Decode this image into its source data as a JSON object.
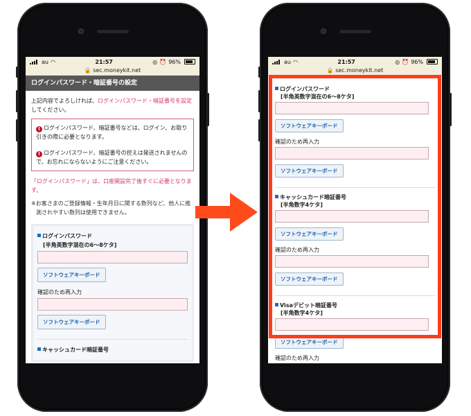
{
  "status": {
    "carrier": "au",
    "time": "21:57",
    "battery": "96%"
  },
  "url": "sec.moneykit.net",
  "left_screen": {
    "header": "ログインパスワード・暗証番号の設定",
    "intro_before": "上記内容でよろしければ、",
    "intro_link": "ログインパスワード・暗証番号を設定",
    "intro_after": "してください。",
    "notices": [
      "ログインパスワード、暗証番号などは、ログイン、お取り引きの際に必要となります。",
      "ログインパスワード、暗証番号の控えは発送されませんので、お忘れにならないようにご注意ください。"
    ],
    "pink_note": "「ログインパスワード」は、口座開設完了後すぐに必要となります。",
    "gray_note": "※お客さまのご登録情報・生年月日に関する数列など、他人に推測されやすい数列は使用できません。",
    "section1_title": "ログインパスワード",
    "section1_sub": "[半角英数字混在の6～8ケタ]",
    "keyboard_button": "ソフトウェアキーボード",
    "confirm_label": "確認のため再入力",
    "section2_title": "キャッシュカード暗証番号"
  },
  "right_screen": {
    "section1_title": "ログインパスワード",
    "section1_sub": "[半角英数字混在の6～8ケタ]",
    "section2_title": "キャッシュカード暗証番号",
    "section2_sub": "[半角数字4ケタ]",
    "section3_title": "Visaデビット暗証番号",
    "section3_sub": "[半角数字4ケタ]",
    "keyboard_button": "ソフトウェアキーボード",
    "confirm_label": "確認のため再入力"
  },
  "colors": {
    "highlight": "#ff3d1a",
    "arrow": "#ff4a1c",
    "link_pink": "#d6336c"
  },
  "icons": [
    "signal-icon",
    "wifi-icon",
    "lock-icon",
    "battery-icon",
    "warning-icon",
    "arrow-right-icon"
  ]
}
